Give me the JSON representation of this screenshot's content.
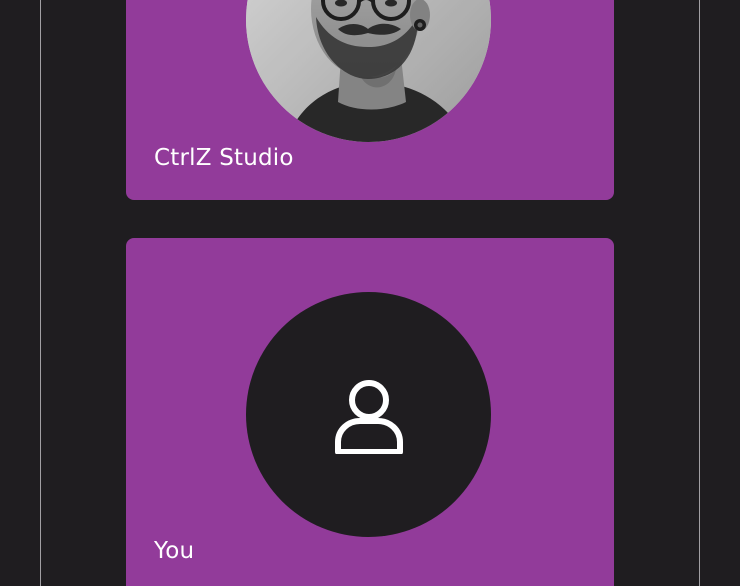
{
  "tiles": [
    {
      "label": "CtrlZ Studio",
      "media": "video-feed-photo",
      "icon": "participant-photo"
    },
    {
      "label": "You",
      "media": "no-video",
      "icon": "user-icon"
    }
  ],
  "colors": {
    "background": "#1f1d20",
    "tile": "#923b9a",
    "text": "#ffffff",
    "frame_line": "#b9b6bb"
  }
}
